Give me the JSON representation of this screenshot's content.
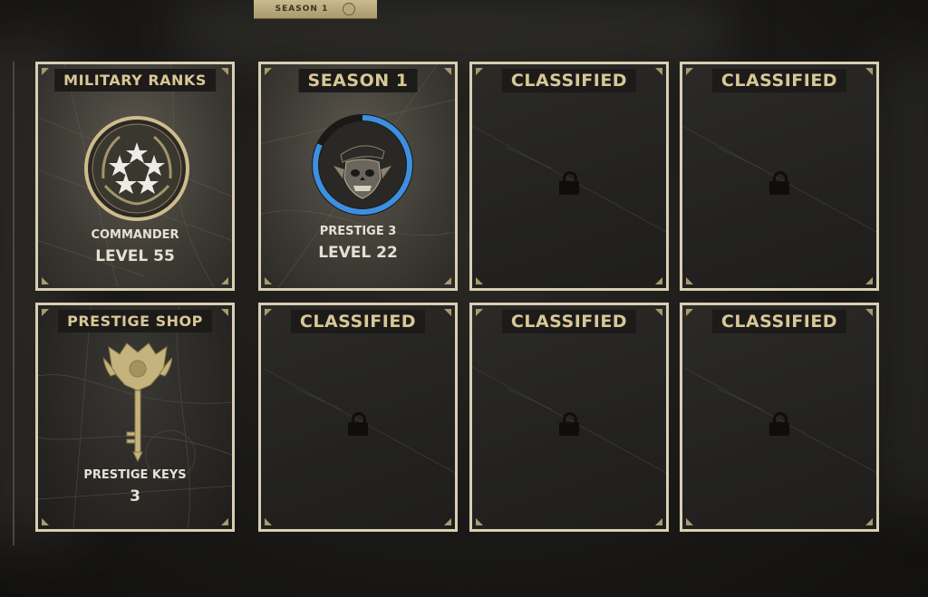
{
  "header": {
    "season_tab_label": "SEASON 1"
  },
  "cards": {
    "military_ranks": {
      "title": "MILITARY RANKS",
      "rank_name": "COMMANDER",
      "level": "LEVEL 55"
    },
    "season": {
      "title": "SEASON 1",
      "prestige": "PRESTIGE 3",
      "level": "LEVEL 22",
      "progress": 0.82
    },
    "prestige_shop": {
      "title": "PRESTIGE SHOP",
      "currency_label": "PRESTIGE KEYS",
      "currency_count": "3"
    },
    "locked_title": "CLASSIFIED"
  },
  "colors": {
    "frame": "#d8cfb4",
    "gold": "#d8c797",
    "progress_ring": "#3d8fe0",
    "card_dark": "#242321"
  },
  "icons": {
    "rank": "five-star-wreath-insignia-icon",
    "prestige": "skull-beret-emblem-icon",
    "shop": "prestige-key-icon",
    "locked": "padlock-icon"
  }
}
